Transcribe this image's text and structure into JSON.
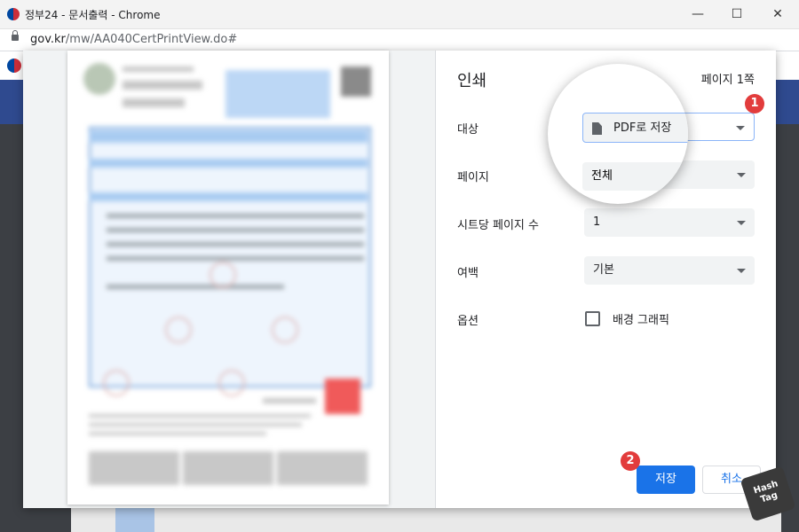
{
  "window": {
    "title": "정부24 - 문서출력 - Chrome",
    "minimize": "—",
    "maximize": "☐",
    "close": "✕",
    "url_host": "gov.kr",
    "url_path": "/mw/AA040CertPrintView.do#"
  },
  "print": {
    "title": "인쇄",
    "page_count": "페이지 1쪽",
    "labels": {
      "destination": "대상",
      "pages": "페이지",
      "pages_per_sheet": "시트당 페이지 수",
      "margins": "여백",
      "options": "옵션"
    },
    "destination_value": "PDF로 저장",
    "pages_value": "전체",
    "pages_per_sheet_value": "1",
    "margins_value": "기본",
    "background_graphics_label": "배경 그래픽",
    "background_graphics_checked": false,
    "save_button": "저장",
    "cancel_button": "취소"
  },
  "annotations": {
    "badge1": "1",
    "badge2": "2"
  },
  "watermark": {
    "line1": "Hash",
    "line2": "Tag"
  },
  "colors": {
    "accent": "#1a73e8",
    "badge": "#e23c3c",
    "nav": "#2f4a8f"
  }
}
